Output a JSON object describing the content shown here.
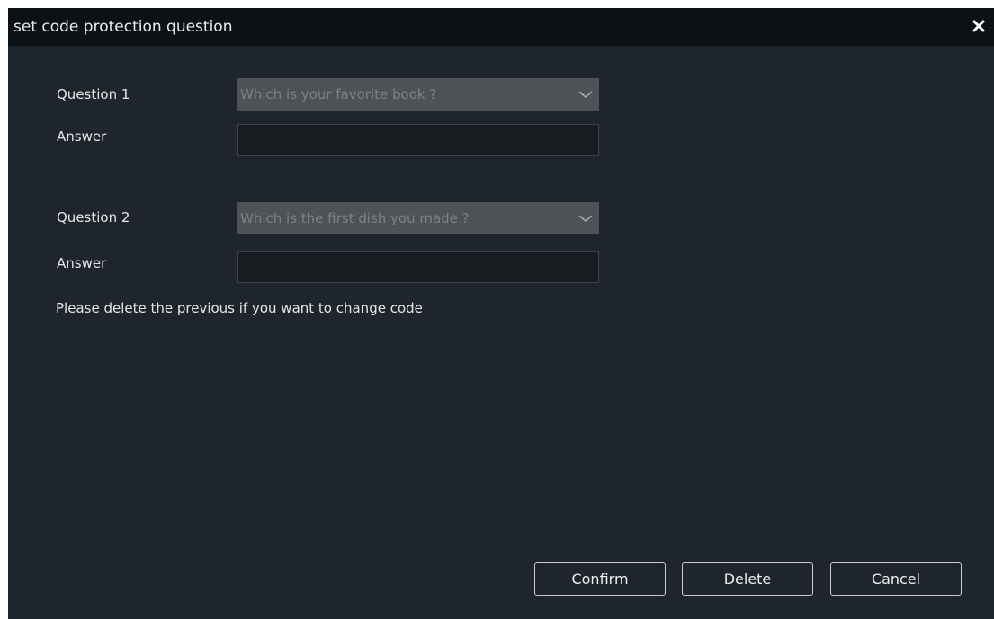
{
  "dialog": {
    "title": "set code protection question",
    "close_icon": "close-icon"
  },
  "form": {
    "question1": {
      "label": "Question 1",
      "selected": "Which is your favorite book ?",
      "dropdown_icon": "chevron-down-icon"
    },
    "answer1": {
      "label": "Answer",
      "value": ""
    },
    "question2": {
      "label": "Question 2",
      "selected": "Which is the first dish you made ?",
      "dropdown_icon": "chevron-down-icon"
    },
    "answer2": {
      "label": "Answer",
      "value": ""
    },
    "note": "Please delete the previous if you want to change code"
  },
  "buttons": {
    "confirm": "Confirm",
    "delete": "Delete",
    "cancel": "Cancel"
  },
  "colors": {
    "window_background": "#1f252d",
    "titlebar_background": "#0c1116",
    "select_background": "#4c5156",
    "input_background": "#181b1f",
    "text": "#e6e6e6",
    "placeholder_text": "#7d8287"
  }
}
